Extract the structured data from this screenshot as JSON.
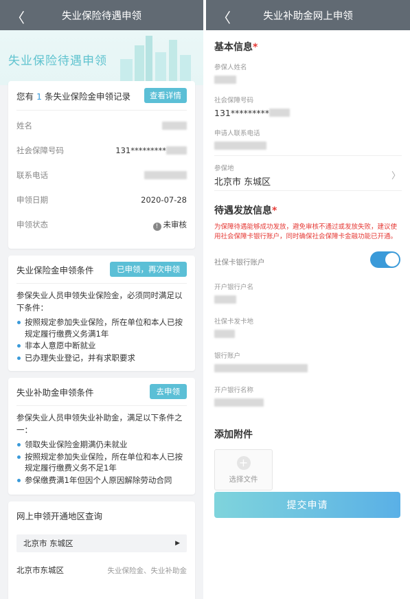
{
  "left": {
    "nav_title": "失业保险待遇申领",
    "back_glyph": "〈",
    "hero_title": "失业保险待遇申领",
    "record": {
      "prefix": "您有",
      "count": "1",
      "suffix": "条失业保险金申领记录",
      "detail_button": "查看详情",
      "rows": [
        {
          "label": "姓名",
          "value": ""
        },
        {
          "label": "社会保障号码",
          "value": "131*********"
        },
        {
          "label": "联系电话",
          "value": ""
        },
        {
          "label": "申领日期",
          "value": "2020-07-28"
        },
        {
          "label": "申领状态",
          "value": "未审核"
        }
      ]
    },
    "insurance_cond": {
      "title": "失业保险金申领条件",
      "button": "已申领，再次申领",
      "intro": "参保失业人员申领失业保险金，必须同时满足以下条件：",
      "items": [
        "按照规定参加失业保险，所在单位和本人已按规定履行缴费义务满1年",
        "非本人意愿中断就业",
        "已办理失业登记，并有求职要求"
      ]
    },
    "subsidy_cond": {
      "title": "失业补助金申领条件",
      "button": "去申领",
      "intro": "参保失业人员申领失业补助金，满足以下条件之一：",
      "items": [
        "领取失业保险金期满仍未就业",
        "按照规定参加失业保险，所在单位和本人已按规定履行缴费义务不足1年",
        "参保缴费满1年但因个人原因解除劳动合同"
      ]
    },
    "region": {
      "title": "网上申领开通地区查询",
      "select_value": "北京市 东城区",
      "result_area": "北京市东城区",
      "result_types": "失业保险金、失业补助金"
    }
  },
  "right": {
    "nav_title": "失业补助金网上申领",
    "back_glyph": "〈",
    "basic": {
      "title": "基本信息",
      "star": "*",
      "fields": [
        {
          "label": "参保人姓名",
          "value": ""
        },
        {
          "label": "社会保障号码",
          "value": "131*********"
        },
        {
          "label": "申请人联系电话",
          "value": ""
        },
        {
          "label": "参保地",
          "value": "北京市 东城区"
        }
      ]
    },
    "pay": {
      "title": "待遇发放信息",
      "star": "*",
      "notice": "为保障待遇能够成功发放，避免审核不通过或发放失败，建议使用社会保障卡银行账户，同时确保社会保障卡金融功能已开通。",
      "toggle_label": "社保卡银行账户",
      "toggle_on": true,
      "fields": [
        {
          "label": "开户银行户名",
          "value": ""
        },
        {
          "label": "社保卡发卡地",
          "value": ""
        },
        {
          "label": "银行账户",
          "value": ""
        },
        {
          "label": "开户银行名称",
          "value": ""
        }
      ]
    },
    "attach": {
      "title": "添加附件",
      "upload_label": "选择文件"
    },
    "submit": "提交申请"
  },
  "colors": {
    "nav_bg": "#616a73",
    "accent": "#5bbfd6",
    "link_blue": "#3a9ad9",
    "required": "#e53935"
  }
}
